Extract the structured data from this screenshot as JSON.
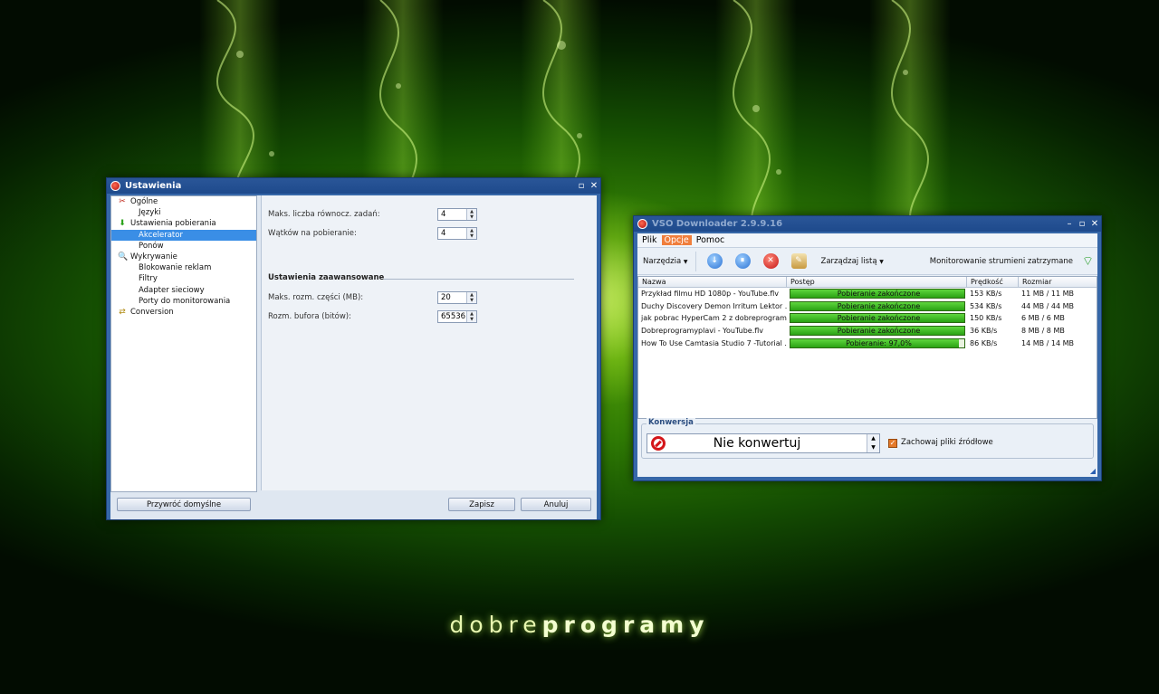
{
  "brand": {
    "light": "dobre",
    "bold": "programy"
  },
  "settings": {
    "title": "Ustawienia",
    "tree": [
      {
        "label": "Ogólne",
        "level": 0,
        "icon": "tools-icon",
        "glyph": "✂",
        "color": "#c0281c"
      },
      {
        "label": "Języki",
        "level": 1
      },
      {
        "label": "Ustawienia pobierania",
        "level": 0,
        "icon": "download-arrow-icon",
        "glyph": "⬇",
        "color": "#2aa21a"
      },
      {
        "label": "Akcelerator",
        "level": 1,
        "selected": true
      },
      {
        "label": "Ponów",
        "level": 1
      },
      {
        "label": "Wykrywanie",
        "level": 0,
        "icon": "magnifier-icon",
        "glyph": "🔍",
        "color": "#2a5fb0"
      },
      {
        "label": "Blokowanie reklam",
        "level": 1
      },
      {
        "label": "Filtry",
        "level": 1
      },
      {
        "label": "Adapter sieciowy",
        "level": 1
      },
      {
        "label": "Porty do monitorowania",
        "level": 1
      },
      {
        "label": "Conversion",
        "level": 0,
        "icon": "conversion-icon",
        "glyph": "⇄",
        "color": "#b08a10"
      }
    ],
    "fields": {
      "max_tasks_label": "Maks. liczba równocz. zadań:",
      "max_tasks_value": "4",
      "threads_label": "Wątków na pobieranie:",
      "threads_value": "4",
      "advanced_title": "Ustawienia zaawansowane",
      "max_part_label": "Maks. rozm. części (MB):",
      "max_part_value": "20",
      "buffer_label": "Rozm. bufora (bitów):",
      "buffer_value": "65536"
    },
    "buttons": {
      "restore": "Przywróć domyślne",
      "save": "Zapisz",
      "cancel": "Anuluj"
    }
  },
  "vso": {
    "title": "VSO Downloader 2.9.9.16",
    "menu": [
      "Plik",
      "Opcje",
      "Pomoc"
    ],
    "toolbar": {
      "tools_label": "Narzędzia",
      "manage_label": "Zarządzaj listą",
      "status_text": "Monitorowanie strumieni zatrzymane"
    },
    "columns": [
      "Nazwa",
      "Postęp",
      "Prędkość",
      "Rozmiar"
    ],
    "rows": [
      {
        "name": "Przykład filmu HD 1080p - YouTube.flv",
        "progress": 1.0,
        "progress_label": "Pobieranie zakończone",
        "speed": "153 KB/s",
        "size": "11 MB / 11 MB"
      },
      {
        "name": "Duchy Discovery Demon Irritum Lektor ...",
        "progress": 1.0,
        "progress_label": "Pobieranie zakończone",
        "speed": "534 KB/s",
        "size": "44 MB / 44 MB"
      },
      {
        "name": "jak pobrac HyperCam 2 z dobreprogram...",
        "progress": 1.0,
        "progress_label": "Pobieranie zakończone",
        "speed": "150 KB/s",
        "size": "6 MB / 6 MB"
      },
      {
        "name": "Dobreprogramyplavi - YouTube.flv",
        "progress": 1.0,
        "progress_label": "Pobieranie zakończone",
        "speed": "36 KB/s",
        "size": "8 MB / 8 MB"
      },
      {
        "name": "How To Use Camtasia Studio 7 -Tutorial ...",
        "progress": 0.97,
        "progress_label": "Pobieranie: 97,0%",
        "speed": "86 KB/s",
        "size": "14 MB / 14 MB"
      }
    ],
    "conversion": {
      "caption": "Konwersja",
      "selected": "Nie konwertuj",
      "keep_source_label": "Zachowaj pliki źródłowe",
      "keep_source_checked": true
    }
  }
}
